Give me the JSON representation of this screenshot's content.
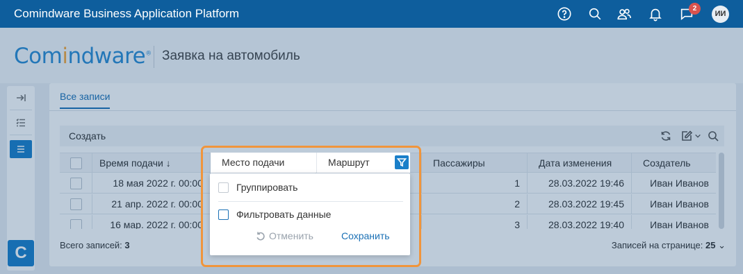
{
  "topbar": {
    "title": "Comindware Business Application Platform",
    "icons": [
      "help-icon",
      "search-icon",
      "users-icon",
      "bell-icon",
      "chat-icon"
    ],
    "badge_count": "2",
    "avatar_initials": "ИИ"
  },
  "header": {
    "logo_text": "Comindware",
    "page_title": "Заявка на автомобиль"
  },
  "left_panel": {
    "buttons": [
      "collapse-icon",
      "task-list-icon",
      "menu-icon"
    ],
    "app_logo_letter": "C"
  },
  "main": {
    "tab_label": "Все записи",
    "toolbar": {
      "create_label": "Создать",
      "icons": [
        "refresh-icon",
        "edit-icon",
        "search-icon"
      ]
    },
    "table": {
      "columns": [
        "Время подачи ↓",
        "Место подачи",
        "Маршрут",
        "Пассажиры",
        "Дата изменения",
        "Создатель"
      ],
      "rows": [
        {
          "time": "18 мая 2022 г. 00:00",
          "place": "",
          "route": "",
          "passengers": "1",
          "modified": "28.03.2022 19:46",
          "creator": "Иван Иванов"
        },
        {
          "time": "21 апр. 2022 г. 00:00",
          "place": "",
          "route": "",
          "passengers": "2",
          "modified": "28.03.2022 19:45",
          "creator": "Иван Иванов"
        },
        {
          "time": "16 мар. 2022 г. 00:00",
          "place": "",
          "route": "",
          "passengers": "3",
          "modified": "28.03.2022 19:40",
          "creator": "Иван Иванов"
        }
      ]
    },
    "footer": {
      "total_label": "Всего записей:",
      "total_value": "3",
      "per_page_label": "Записей на странице:",
      "per_page_value": "25"
    }
  },
  "popup": {
    "group_label": "Группировать",
    "filter_label": "Фильтровать данные",
    "cancel_label": "Отменить",
    "save_label": "Сохранить"
  },
  "colors": {
    "topbar": "#0e5e9d",
    "accent": "#1a7fc9",
    "highlight": "#f0953c"
  }
}
